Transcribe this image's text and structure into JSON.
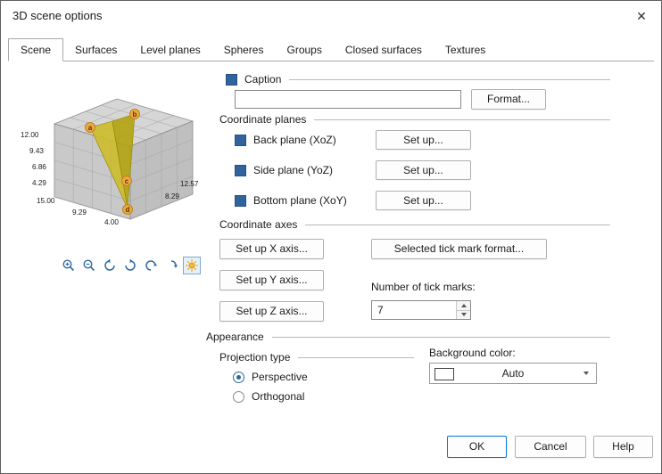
{
  "window": {
    "title": "3D scene options",
    "close_icon": "✕"
  },
  "tabs": [
    {
      "label": "Scene"
    },
    {
      "label": "Surfaces"
    },
    {
      "label": "Level planes"
    },
    {
      "label": "Spheres"
    },
    {
      "label": "Groups"
    },
    {
      "label": "Closed surfaces"
    },
    {
      "label": "Textures"
    }
  ],
  "preview": {
    "z_ticks": [
      "12.00",
      "9.43",
      "6.86",
      "4.29"
    ],
    "bottom_ticks": [
      "15.00",
      "9.29",
      "4.00"
    ],
    "right_ticks": [
      "12.57",
      "8.29"
    ],
    "point_labels": [
      "a",
      "b",
      "c",
      "d"
    ]
  },
  "caption": {
    "label": "Caption",
    "value": "",
    "format_button": "Format..."
  },
  "coordinate_planes": {
    "header": "Coordinate planes",
    "setup_button": "Set up...",
    "planes": [
      {
        "label": "Back plane (XoZ)"
      },
      {
        "label": "Side plane (YoZ)"
      },
      {
        "label": "Bottom plane (XoY)"
      }
    ]
  },
  "coordinate_axes": {
    "header": "Coordinate axes",
    "x_button": "Set up X axis...",
    "y_button": "Set up Y axis...",
    "z_button": "Set up Z axis...",
    "tick_format_button": "Selected tick mark format...",
    "tick_marks_label": "Number of tick marks:",
    "tick_marks_value": "7"
  },
  "appearance": {
    "header": "Appearance",
    "projection_label": "Projection type",
    "perspective_label": "Perspective",
    "orthogonal_label": "Orthogonal",
    "background_label": "Background color:",
    "background_value": "Auto"
  },
  "footer": {
    "ok": "OK",
    "cancel": "Cancel",
    "help": "Help"
  },
  "colors": {
    "accent": "#2e6da4",
    "checkbox": "#31639c",
    "ok_border": "#0078d7",
    "cone": "#cdbb2a",
    "marker": "#f0a73e"
  }
}
